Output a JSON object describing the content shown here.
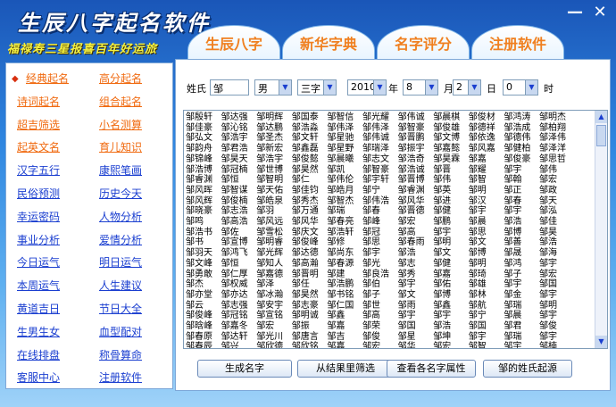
{
  "window": {
    "title": "生辰八字起名软件",
    "slogan": "福禄寿三星报喜百年好运旅",
    "close_label": "✕",
    "minimize_label": "—"
  },
  "tabs": [
    "生辰八字",
    "新华字典",
    "名字评分",
    "注册软件"
  ],
  "sidebar": {
    "items": [
      {
        "label": "经典起名",
        "color": "orange"
      },
      {
        "label": "高分起名",
        "color": "orange"
      },
      {
        "label": "诗词起名",
        "color": "orange"
      },
      {
        "label": "组合起名",
        "color": "orange"
      },
      {
        "label": "超吉筛选",
        "color": "orange"
      },
      {
        "label": "小名测算",
        "color": "orange"
      },
      {
        "label": "起英文名",
        "color": "orange"
      },
      {
        "label": "育儿知识",
        "color": "orange"
      },
      {
        "label": "汉字五行",
        "color": "blue"
      },
      {
        "label": "康熙笔画",
        "color": "blue"
      },
      {
        "label": "民俗预测",
        "color": "blue"
      },
      {
        "label": "历史今天",
        "color": "blue"
      },
      {
        "label": "幸运密码",
        "color": "blue"
      },
      {
        "label": "人物分析",
        "color": "blue"
      },
      {
        "label": "事业分析",
        "color": "blue"
      },
      {
        "label": "爱情分析",
        "color": "blue"
      },
      {
        "label": "今日运气",
        "color": "blue"
      },
      {
        "label": "明日运气",
        "color": "blue"
      },
      {
        "label": "本周运气",
        "color": "blue"
      },
      {
        "label": "人生建议",
        "color": "blue"
      },
      {
        "label": "黄道吉日",
        "color": "blue"
      },
      {
        "label": "节日大全",
        "color": "blue"
      },
      {
        "label": "生男生女",
        "color": "blue"
      },
      {
        "label": "血型配对",
        "color": "blue"
      },
      {
        "label": "在线排盘",
        "color": "blue"
      },
      {
        "label": "称骨算命",
        "color": "blue"
      },
      {
        "label": "客服中心",
        "color": "blue"
      },
      {
        "label": "注册软件",
        "color": "blue"
      }
    ]
  },
  "form": {
    "surname_label": "姓氏",
    "surname_value": "邹",
    "gender_value": "男",
    "chars_value": "三字",
    "year_value": "2010",
    "year_label": "年",
    "month_value": "8",
    "month_label": "月",
    "day_value": "2",
    "day_label": "日",
    "hour_value": "0",
    "hour_label": "时"
  },
  "names_columns": [
    [
      "邹殷轩",
      "邹佳豪",
      "邹弘文",
      "邹韵舟",
      "邹锦峰",
      "邹浩博",
      "邹睿渊",
      "邹风晖",
      "邹风辉",
      "邹晓豪",
      "邹鸣",
      "邹浩书",
      "邹书",
      "邹羽天",
      "邹文峰",
      "邹勇敢",
      "邹杰",
      "邹亦堂",
      "邹云",
      "邹俊峰",
      "邹晗峰",
      "邹春原",
      "邹春辰",
      "邹丁"
    ],
    [
      "邹达强",
      "邹沁铭",
      "邹浩宇",
      "邹君浩",
      "邹昊天",
      "邹冠楠",
      "邹恒",
      "邹智谋",
      "邹俊楠",
      "邹志浩",
      "邹高浩",
      "邹佐",
      "邹宣博",
      "邹鸿飞",
      "邹恒",
      "邹仁厚",
      "邹权威",
      "邹亦达",
      "邹志强",
      "邹冠铭",
      "邹嘉冬",
      "邹达轩",
      "邹兴",
      "邹冬雪"
    ],
    [
      "邹明辉",
      "邹达鹏",
      "邹圣杰",
      "邹新宏",
      "邹浩宇",
      "邹世博",
      "邹智明",
      "邹天佑",
      "邹皓泉",
      "邹羽",
      "邹风远",
      "邹雪松",
      "邹明睿",
      "邹光辉",
      "邹知人",
      "邹嘉德",
      "邹泽",
      "邹冰瀚",
      "邹安宇",
      "邹宣铭",
      "邹宏",
      "邹光川",
      "邹欣德",
      "邹林"
    ],
    [
      "邹国泰",
      "邹浩淼",
      "邹文轩",
      "邹鑫磊",
      "邹俊懿",
      "邹昊然",
      "邹仁",
      "邹佳钧",
      "邹秀杰",
      "邹万通",
      "邹风华",
      "邹庆文",
      "邹俊峰",
      "邹达德",
      "邹高瀚",
      "邹晋明",
      "邹任",
      "邹昊然",
      "邹志豪",
      "邹明诚",
      "邹振",
      "邹唐言",
      "邹欣铭",
      "邹鑫为"
    ],
    [
      "邹智信",
      "邹伟泽",
      "邹星驰",
      "邹星野",
      "邹晨曦",
      "邹凯",
      "邹伟伦",
      "邹皓月",
      "邹智杰",
      "邹瑞",
      "邹春亮",
      "邹浩轩",
      "邹修",
      "邹尚东",
      "邹春源",
      "邹建",
      "邹浩鹏",
      "邹书铭",
      "邹仁国",
      "邹鑫",
      "邹嘉",
      "邹吉",
      "邹嘉",
      "邹泽洋"
    ],
    [
      "邹光耀",
      "邹伟泽",
      "邹伟诚",
      "邹瑞泽",
      "邹志文",
      "邹智豪",
      "邹宇轩",
      "邹宁",
      "邹伟浩",
      "邹春",
      "邹峰",
      "邹冠",
      "邹思",
      "邹宇",
      "邹光",
      "邹良浩",
      "邹伯",
      "邹子",
      "邹世",
      "邹高",
      "邹荣",
      "邹俊",
      "邹宏",
      "邹嘉"
    ],
    [
      "邹伟诚",
      "邹智豪",
      "邹晋鹏",
      "邹振宇",
      "邹浩奇",
      "邹浩诚",
      "邹晋博",
      "邹睿渊",
      "邹风华",
      "邹晋德",
      "邹宏",
      "邹高",
      "邹春雨",
      "邹浩",
      "邹志",
      "邹秀",
      "邹宇",
      "邹文",
      "邹雨",
      "邹宇",
      "邹国",
      "邹星",
      "邹华",
      "邹冬"
    ],
    [
      "邹晨棋",
      "邹俊雄",
      "邹文博",
      "邹嘉懿",
      "邹昊霖",
      "邹晋",
      "邹伟",
      "邹英",
      "邹进",
      "邹健",
      "邹鹏",
      "邹宇",
      "邹明",
      "邹文",
      "邹健",
      "邹嘉",
      "邹佑",
      "邹博",
      "邹鑫",
      "邹宇",
      "邹浩",
      "邹坤",
      "邹宏",
      "邹风"
    ],
    [
      "邹俊材",
      "邹德祥",
      "邹依逸",
      "邹风嘉",
      "邹嘉",
      "邹耀",
      "邹智",
      "邹明",
      "邹汉",
      "邹宇",
      "邹晨",
      "邹思",
      "邹文",
      "邹博",
      "邹明",
      "邹琦",
      "邹雄",
      "邹林",
      "邹航",
      "邹宁",
      "邹国",
      "邹宇",
      "邹智",
      "邹林"
    ],
    [
      "邹鸿涛",
      "邹浩成",
      "邹德伟",
      "邹健柏",
      "邹俊豪",
      "邹宇",
      "邹翰",
      "邹正",
      "邹春",
      "邹宇",
      "邹浩",
      "邹博",
      "邹善",
      "邹晟",
      "邹鸿",
      "邹子",
      "邹宇",
      "邹金",
      "邹瑞",
      "邹晨",
      "邹君",
      "邹瑞",
      "邹宇",
      "邹文"
    ],
    [
      "邹明杰",
      "邹柏翔",
      "邹泽伟",
      "邹泽洋",
      "邹思哲",
      "邹伟",
      "邹宏",
      "邹政",
      "邹天",
      "邹泓",
      "邹佳",
      "邹昊",
      "邹浩",
      "邹海",
      "邹宇",
      "邹宏",
      "邹国",
      "邹宇",
      "邹明",
      "邹宇",
      "邹俊",
      "邹宇",
      "邹楠",
      "邹涛"
    ]
  ],
  "buttons": {
    "generate": "生成名字",
    "filter": "从结果里筛选",
    "view_props": "查看各名字属性",
    "origin": "邹的姓氏起源"
  }
}
